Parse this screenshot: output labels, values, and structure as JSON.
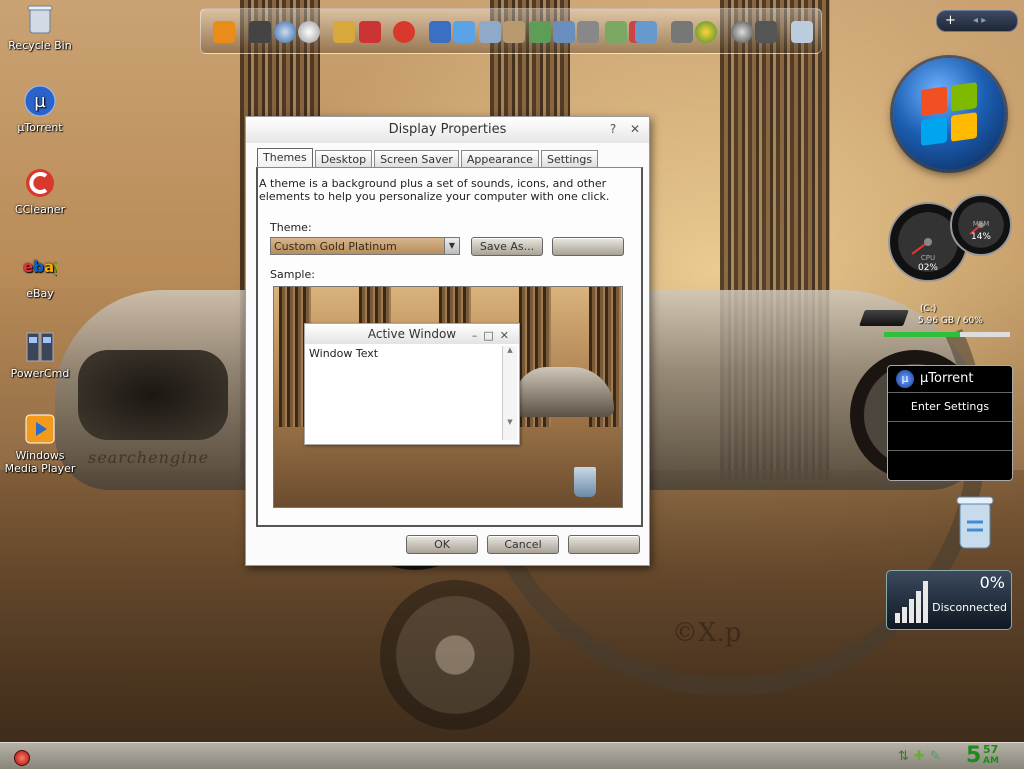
{
  "desktop": {
    "icons": [
      {
        "label": "Recycle Bin",
        "icon": "recycle-bin-icon"
      },
      {
        "label": "µTorrent",
        "icon": "utorrent-icon"
      },
      {
        "label": "CCleaner",
        "icon": "ccleaner-icon"
      },
      {
        "label": "eBay",
        "icon": "ebay-icon"
      },
      {
        "label": "PowerCmd",
        "icon": "powercmd-icon"
      },
      {
        "label": "Windows Media Player",
        "icon": "media-player-icon"
      }
    ],
    "watermark": "©X.p",
    "plate_text": "searchengine"
  },
  "top_right_bar": {
    "plus": "+",
    "arrows": "◂ ▸"
  },
  "gadgets": {
    "cpu": {
      "label": "CPU",
      "value": "02%"
    },
    "mem": {
      "label": "MEM",
      "value": "14%"
    },
    "drive": {
      "name": "(C:)",
      "usage": "5.96 GB / 60%",
      "fill_percent": 60
    },
    "utorrent": {
      "title": "µTorrent",
      "action": "Enter Settings",
      "logo": "µ"
    },
    "network": {
      "percent": "0%",
      "status": "Disconnected"
    }
  },
  "taskbar": {
    "clock_hour": "5",
    "clock_minute": "57",
    "clock_ampm": "AM"
  },
  "dialog": {
    "title": "Display Properties",
    "help_button": "?",
    "close_button": "✕",
    "tabs": [
      "Themes",
      "Desktop",
      "Screen Saver",
      "Appearance",
      "Settings"
    ],
    "active_tab": "Themes",
    "description": "A theme is a background plus a set of sounds, icons, and other elements to help you personalize your computer with one click.",
    "theme_label": "Theme:",
    "theme_value": "Custom Gold Platinum",
    "save_as": "Save As...",
    "delete": "",
    "sample_label": "Sample:",
    "preview": {
      "title": "Active Window",
      "text": "Window Text"
    },
    "ok": "OK",
    "cancel": "Cancel",
    "apply": ""
  },
  "colors": {
    "accent": "#c8a06a",
    "selection": "#b68d5f",
    "green_clock": "#1a8c1a"
  }
}
